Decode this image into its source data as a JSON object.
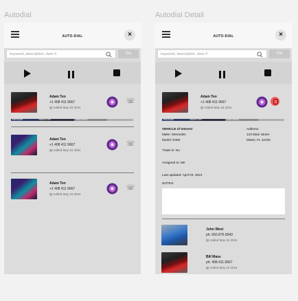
{
  "frames": {
    "left_title": "Autodial",
    "right_title": "Autodial Detail"
  },
  "app": {
    "title": "AUTO-DIAL",
    "search_placeholder": "keyword, description, item #",
    "go_label": "Go",
    "go_color": "#c7c7c7",
    "close_label": "×"
  },
  "list": [
    {
      "name": "Adam Ten",
      "phone": "+1 408 411 9667",
      "added": "Added May 15 2024",
      "photo": "car-red"
    },
    {
      "name": "Adam Ten",
      "phone": "+1 408 411 9667",
      "added": "Added May 15 2024",
      "photo": "car-neon"
    },
    {
      "name": "Adam Ten",
      "phone": "+1 408 411 9667",
      "added": "Added May 15 2024",
      "photo": "car-neon"
    }
  ],
  "status_bar": [
    "ENGAGED",
    "CREDIT APP",
    "TEST DRIVE",
    ""
  ],
  "detail": {
    "contact": {
      "name": "Adam Ten",
      "phone": "+1 408 411 9667",
      "added": "Added May 15 2024"
    },
    "vehicle_heading": "VEHICLE of Interest",
    "make": "Make: Mercedes",
    "model": "Model: E350",
    "address_heading": "Address:",
    "address_line1": "123 Main Street",
    "address_line2": "Miami, FL 12345",
    "trade_in": "Trade-in: No",
    "assigned_to": "Assigned to: Me",
    "last_updated": "Last updated: April 03, 2024",
    "notes_label": "NOTES:",
    "queue": [
      {
        "name": "John West",
        "phone": "ph: 650.876.9943",
        "added": "Added May 15 2024",
        "photo": "car-blue"
      },
      {
        "name": "Bill Mass",
        "phone": "ph: 408.411.9667",
        "added": "Added May 15 2024",
        "photo": "car-red"
      }
    ]
  },
  "icons": {
    "menu": "hamburger-icon",
    "close": "close-icon",
    "search": "search-icon",
    "play": "play-icon",
    "pause": "pause-icon",
    "stop": "stop-icon",
    "dial": "dial-icon",
    "hangup": "hangup-icon",
    "calendar": "calendar-icon"
  },
  "colors": {
    "panel_bg": "#dcdcdc",
    "topbar_bg": "#f7f7f7",
    "end_call_red": "#f05c5c"
  }
}
